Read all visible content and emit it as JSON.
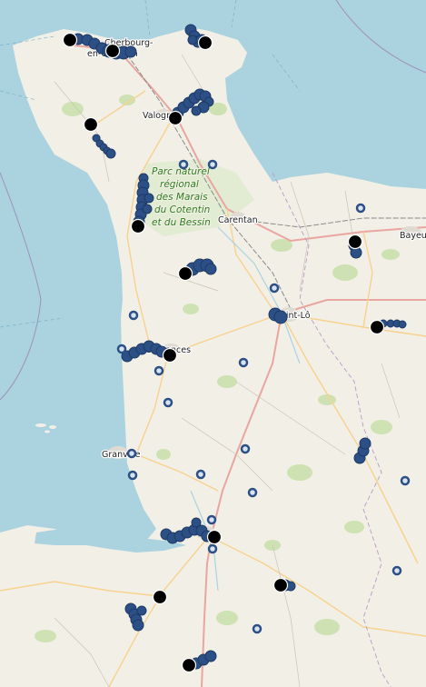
{
  "map": {
    "colors": {
      "sea": "#aad3df",
      "land": "#f2efe6",
      "forest": "#c8dfa9",
      "road_major": "#e9a5a0",
      "road_secondary": "#f7d28f",
      "marker_fill": "#2c4f85",
      "marker_light": "#d8e3f2",
      "start_marker": "#000000"
    },
    "labels": {
      "cherbourg": "Cherbourg-\nen-Cotentin",
      "valognes": "Valognes",
      "carentan": "Carentan",
      "bayeux": "Bayeux",
      "saint_lo": "Saint-Lô",
      "coutances": "Coutances",
      "granville": "Granville",
      "park_1": "Parc naturel",
      "park_2": "régional",
      "park_3": "des Marais",
      "park_4": "du Cotentin",
      "park_5": "et du Bessin"
    }
  }
}
